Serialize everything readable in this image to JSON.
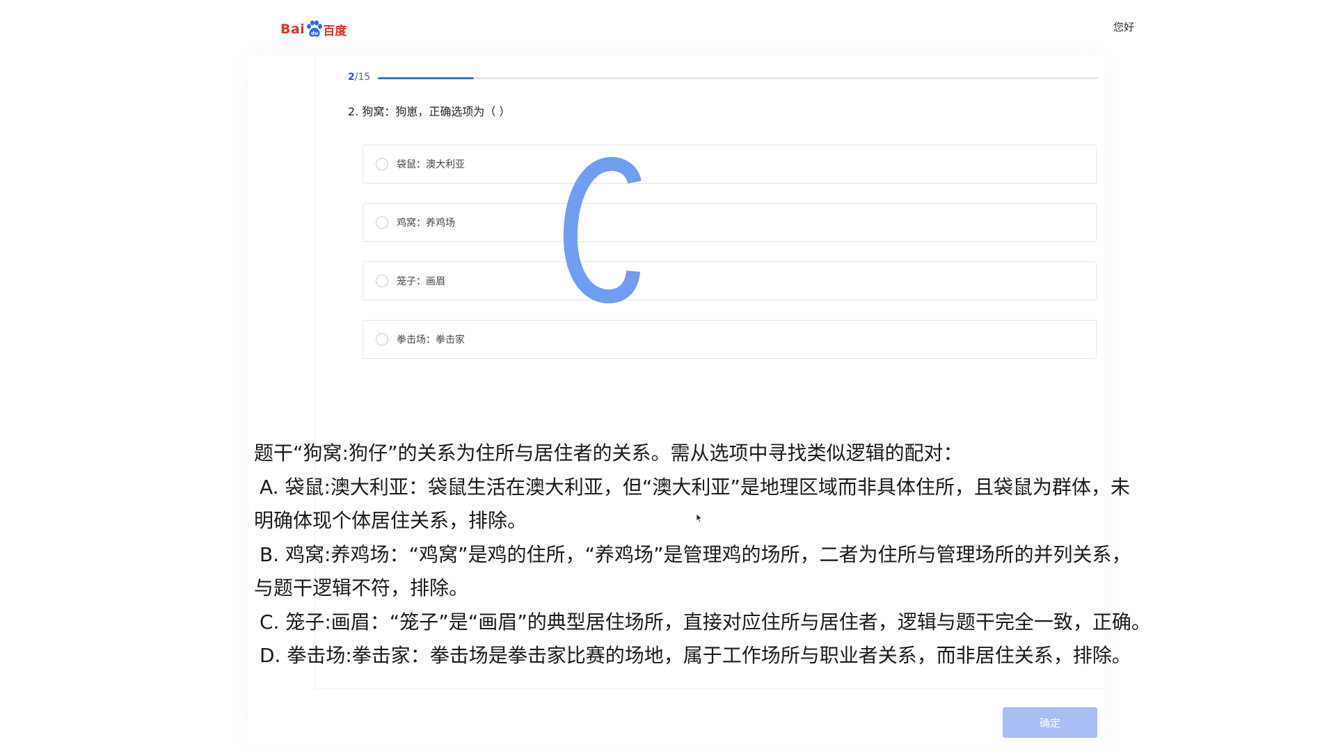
{
  "header": {
    "logo_text_latin": "Bai",
    "logo_text_cn": "百度",
    "logo_icon": "paw-icon",
    "greeting": "您好"
  },
  "progress": {
    "current": "2",
    "total": "/15",
    "fraction": 0.133
  },
  "question": {
    "text": "2. 狗窝：狗崽，正确选项为（    ）"
  },
  "options": [
    {
      "label": "袋鼠：澳大利亚"
    },
    {
      "label": "鸡窝：养鸡场"
    },
    {
      "label": "笼子：画眉"
    },
    {
      "label": "拳击场：拳击家"
    }
  ],
  "overlay_answer": "C",
  "explanation": {
    "intro": "题干“狗窝:狗仔”的关系为住所与居住者的关系。需从选项中寻找类似逻辑的配对：",
    "a_line1": "A. 袋鼠:澳大利亚：袋鼠生活在澳大利亚，但“澳大利亚”是地理区域而非具体住所，且袋鼠为群体，未",
    "a_line2": "明确体现个体居住关系，排除。",
    "b_line1": "B. 鸡窝:养鸡场：“鸡窝”是鸡的住所，“养鸡场”是管理鸡的场所，二者为住所与管理场所的并列关系，",
    "b_line2": "与题干逻辑不符，排除。",
    "c_line": "C. 笼子:画眉：“笼子”是“画眉”的典型居住场所，直接对应住所与居住者，逻辑与题干完全一致，正确。",
    "d_line": "D. 拳击场:拳击家：拳击场是拳击家比赛的场地，属于工作场所与职业者关系，而非居住关系，排除。"
  },
  "footer": {
    "confirm_label": "确定"
  },
  "colors": {
    "brand_red": "#de2f2b",
    "brand_blue": "#2c6ae5",
    "progress": "#3f6fd8",
    "confirm_disabled": "#a7bdf4",
    "overlay_c": "#6f9df2"
  }
}
